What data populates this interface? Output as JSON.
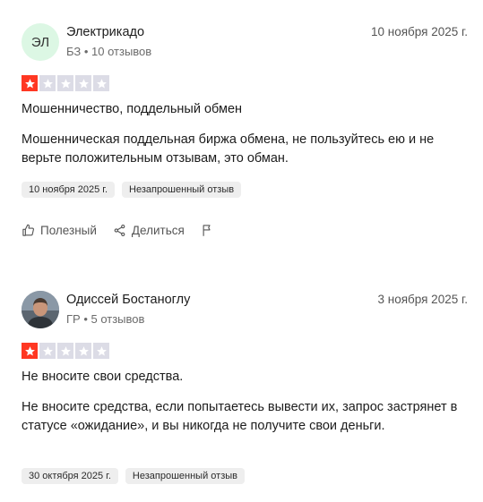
{
  "reviews": [
    {
      "avatar_initials": "ЭЛ",
      "author": "Электрикадо",
      "meta": "БЗ • 10 отзывов",
      "date": "10 ноября 2025 г.",
      "rating": 1,
      "title": "Мошенничество, поддельный обмен",
      "text": "Мошенническая поддельная биржа обмена, не пользуйтесь ею и не верьте положительным отзывам, это обман.",
      "tag_date": "10 ноября 2025 г.",
      "tag_type": "Незапрошенный отзыв",
      "actions": {
        "helpful": "Полезный",
        "share": "Делиться"
      }
    },
    {
      "avatar_initials": "",
      "author": "Одиссей Бостаноглу",
      "meta": "ГР • 5 отзывов",
      "date": "3 ноября 2025 г.",
      "rating": 1,
      "title": "Не вносите свои средства.",
      "text": "Не вносите средства, если попытаетесь вывести их, запрос застрянет в статусе «ожидание», и вы никогда не получите свои деньги.",
      "tag_date": "30 октября 2025 г.",
      "tag_type": "Незапрошенный отзыв"
    }
  ],
  "colors": {
    "star_filled": "#ff3722",
    "star_empty": "#dcdce6",
    "avatar_bg": "#dcf7e4"
  },
  "icons": {
    "star": "star-icon",
    "helpful": "thumbs-up-icon",
    "share": "share-icon",
    "report": "flag-icon"
  }
}
